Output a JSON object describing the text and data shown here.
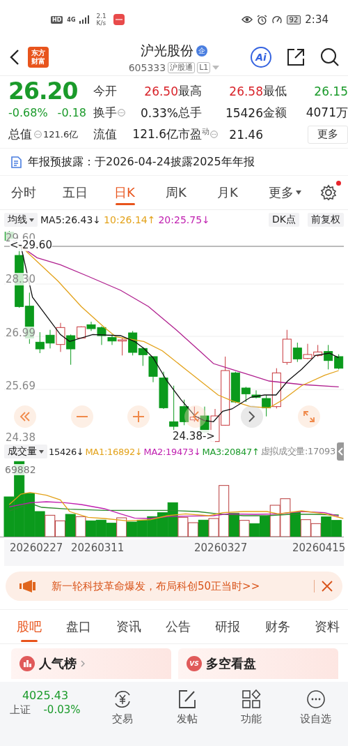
{
  "status_bar": {
    "network_badge": "HD",
    "network_type": "4G",
    "speed": "2.1",
    "speed_unit": "K/s",
    "battery": "92",
    "time": "2:34"
  },
  "header": {
    "logo_lines": [
      "东方",
      "财富"
    ],
    "title": "沪光股份",
    "title_badge": "企",
    "code": "605333",
    "tags": [
      "沪股通",
      "L1"
    ],
    "ai_label": "Ai"
  },
  "quote": {
    "price": "26.20",
    "change_pct": "-0.68%",
    "change": "-0.18",
    "total_value": {
      "label": "总值",
      "value": "121.6亿",
      "info": true
    },
    "stats": [
      {
        "label": "今开",
        "value": "26.50",
        "color": "#d8232a"
      },
      {
        "label": "最高",
        "value": "26.58",
        "color": "#d8232a"
      },
      {
        "label": "最低",
        "value": "26.15",
        "color": "#1a9a2a"
      },
      {
        "label": "换手",
        "value": "0.33%",
        "color": "#222222",
        "info": true
      },
      {
        "label": "总手",
        "value": "15426",
        "color": "#222222"
      },
      {
        "label": "金额",
        "value": "4071万",
        "color": "#222222"
      },
      {
        "label": "流值",
        "value": "121.6亿",
        "color": "#222222"
      },
      {
        "label": "市盈$^{动}$",
        "value": "21.46",
        "color": "#222222",
        "info": true
      }
    ],
    "more_button": "更多"
  },
  "notice": "年报预披露：于2026-04-24披露2025年年报",
  "period_tabs": [
    {
      "label": "分时",
      "selected": false
    },
    {
      "label": "五日",
      "selected": false
    },
    {
      "label": "日K",
      "selected": true
    },
    {
      "label": "周K",
      "selected": false
    },
    {
      "label": "月K",
      "selected": false
    },
    {
      "label": "更多",
      "selected": false,
      "dropdown": true
    }
  ],
  "settings_alert": true,
  "ma_legend": {
    "selector": "均线",
    "items": [
      {
        "text": "MA5:26.43↓",
        "color": "#222222"
      },
      {
        "text": "10:26.14↑",
        "color": "#e3a21a"
      },
      {
        "text": "20:25.75↓",
        "color": "#c020b0"
      }
    ],
    "dk_button": "DK点",
    "adjust_button": "前复权"
  },
  "price_chart": {
    "y_labels": [
      "29.60",
      "28.30",
      "26.99",
      "25.69",
      "24.38"
    ],
    "high_marker": "<-29.60",
    "low_marker": "24.38->"
  },
  "volume": {
    "selector": "成交量",
    "items": [
      {
        "text": "15426↓",
        "color": "#222222"
      },
      {
        "text": "MA1:16892↓",
        "color": "#e3a21a"
      },
      {
        "text": "MA2:19473↓",
        "color": "#c020b0"
      },
      {
        "text": "MA3:20847↑",
        "color": "#1a9a2a"
      },
      {
        "text": "虚拟成交量:17093",
        "color": "#888888"
      }
    ],
    "max_label": "69882",
    "dates": [
      "20260227",
      "20260311",
      "20260327",
      "20260415"
    ]
  },
  "banner": "新一轮科技革命爆发，布局科创50正当时>>",
  "info_tabs": [
    {
      "label": "股吧",
      "selected": true
    },
    {
      "label": "盘口",
      "selected": false
    },
    {
      "label": "资讯",
      "selected": false
    },
    {
      "label": "公告",
      "selected": false
    },
    {
      "label": "研报",
      "selected": false
    },
    {
      "label": "财务",
      "selected": false
    },
    {
      "label": "资料",
      "selected": false
    }
  ],
  "cards": [
    {
      "kind": "ranking",
      "title": "人气榜"
    },
    {
      "kind": "versus",
      "title": "多空看盘",
      "badge": "VS"
    }
  ],
  "bottom_nav": {
    "index": {
      "value": "4025.43",
      "name": "上证",
      "change": "-0.03%"
    },
    "items": [
      {
        "kind": "trade",
        "label": "交易"
      },
      {
        "kind": "post",
        "label": "发帖"
      },
      {
        "kind": "apps",
        "label": "功能"
      },
      {
        "kind": "more",
        "label": "设自选"
      }
    ]
  }
}
